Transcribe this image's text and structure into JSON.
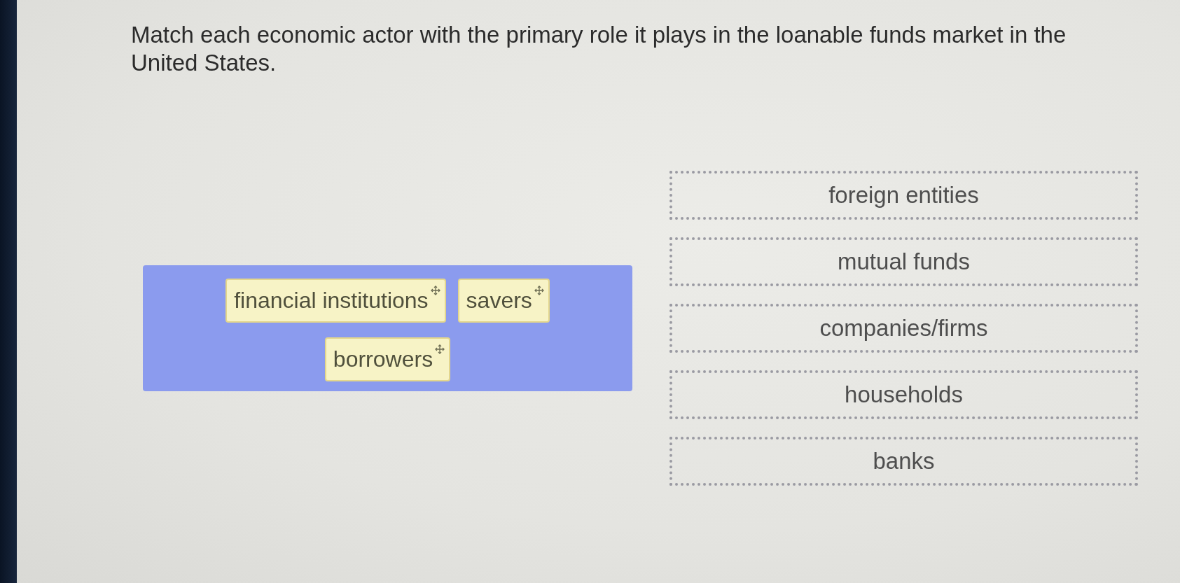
{
  "question": "Match each economic actor with the primary role it plays in the loanable funds market in the United States.",
  "answer_bank": {
    "tiles": [
      {
        "label": "financial institutions"
      },
      {
        "label": "savers"
      },
      {
        "label": "borrowers"
      }
    ]
  },
  "targets": [
    {
      "label": "foreign entities"
    },
    {
      "label": "mutual funds"
    },
    {
      "label": "companies/firms"
    },
    {
      "label": "households"
    },
    {
      "label": "banks"
    }
  ]
}
